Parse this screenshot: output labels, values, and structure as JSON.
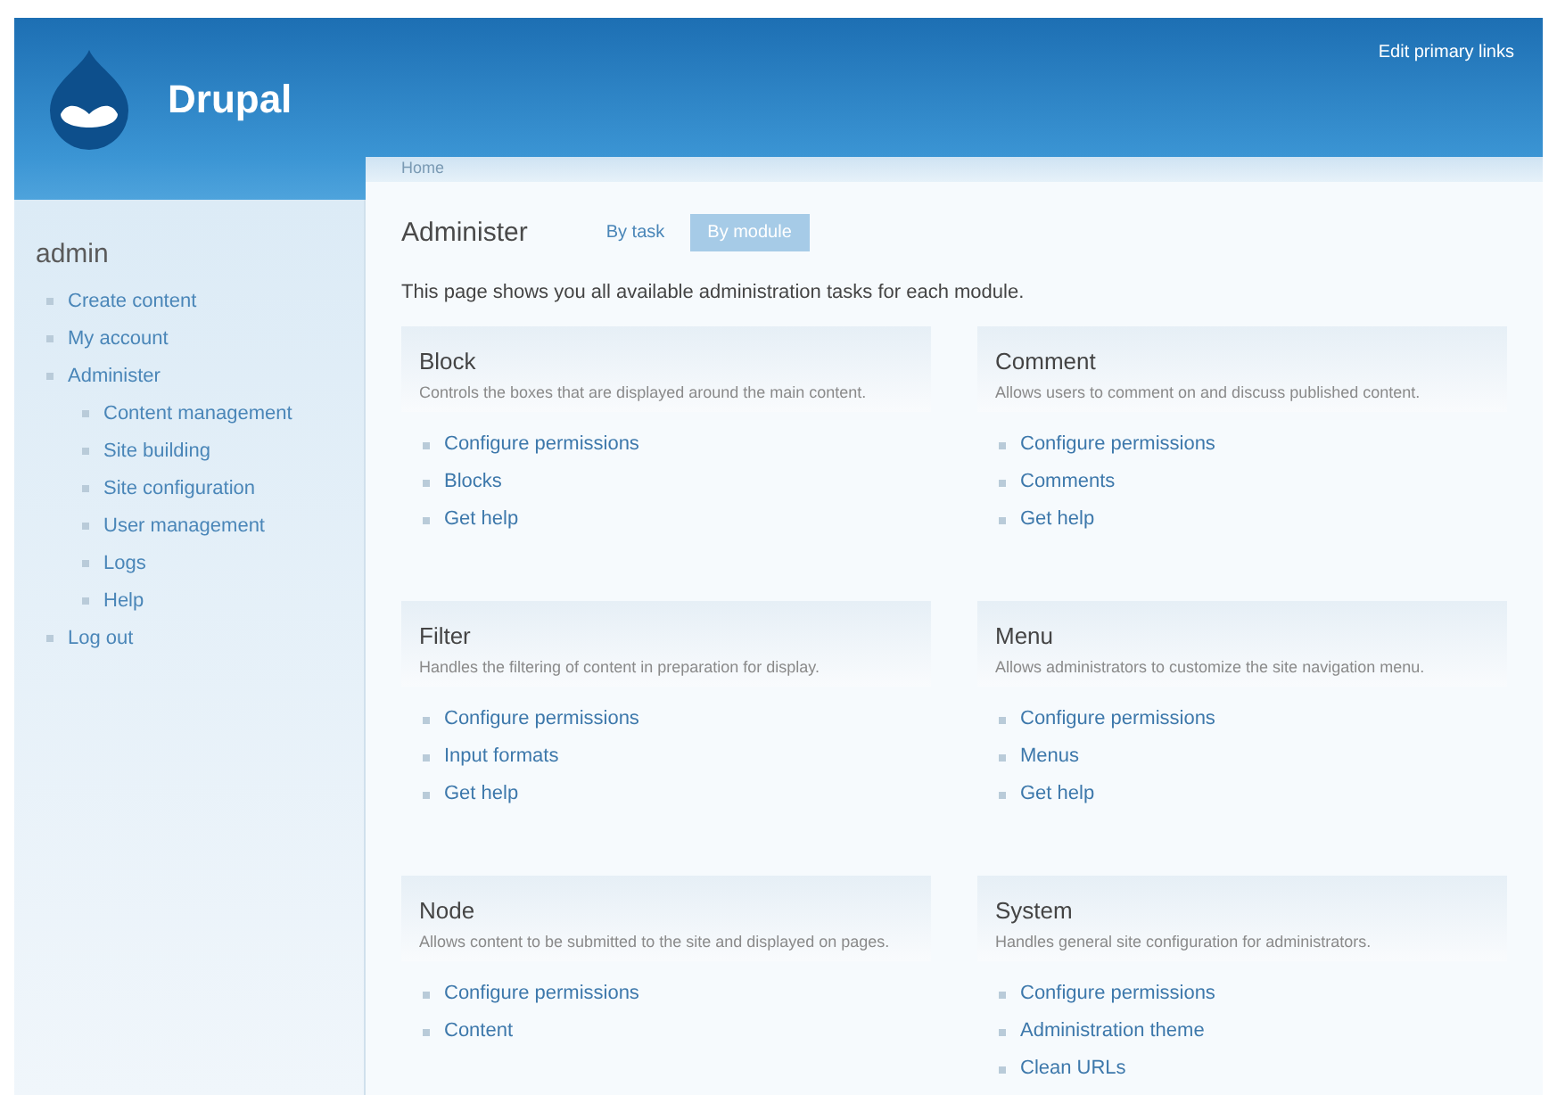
{
  "header": {
    "site_name": "Drupal",
    "links": [
      "Edit primary links"
    ]
  },
  "breadcrumb": [
    "Home"
  ],
  "sidebar": {
    "title": "admin",
    "items": [
      {
        "label": "Create content"
      },
      {
        "label": "My account"
      },
      {
        "label": "Administer",
        "children": [
          {
            "label": "Content management"
          },
          {
            "label": "Site building"
          },
          {
            "label": "Site configuration"
          },
          {
            "label": "User management"
          },
          {
            "label": "Logs"
          },
          {
            "label": "Help"
          }
        ]
      },
      {
        "label": "Log out"
      }
    ]
  },
  "page": {
    "title": "Administer",
    "tabs": [
      {
        "label": "By task",
        "selected": false
      },
      {
        "label": "By module",
        "selected": true
      }
    ],
    "intro": "This page shows you all available administration tasks for each module.",
    "modules": [
      {
        "name": "Block",
        "description": "Controls the boxes that are displayed around the main content.",
        "links": [
          "Configure permissions",
          "Blocks",
          "Get help"
        ]
      },
      {
        "name": "Comment",
        "description": "Allows users to comment on and discuss published content.",
        "links": [
          "Configure permissions",
          "Comments",
          "Get help"
        ]
      },
      {
        "name": "Filter",
        "description": "Handles the filtering of content in preparation for display.",
        "links": [
          "Configure permissions",
          "Input formats",
          "Get help"
        ]
      },
      {
        "name": "Menu",
        "description": "Allows administrators to customize the site navigation menu.",
        "links": [
          "Configure permissions",
          "Menus",
          "Get help"
        ]
      },
      {
        "name": "Node",
        "description": "Allows content to be submitted to the site and displayed on pages.",
        "links": [
          "Configure permissions",
          "Content"
        ]
      },
      {
        "name": "System",
        "description": "Handles general site configuration for administrators.",
        "links": [
          "Configure permissions",
          "Administration theme",
          "Clean URLs"
        ]
      }
    ]
  }
}
